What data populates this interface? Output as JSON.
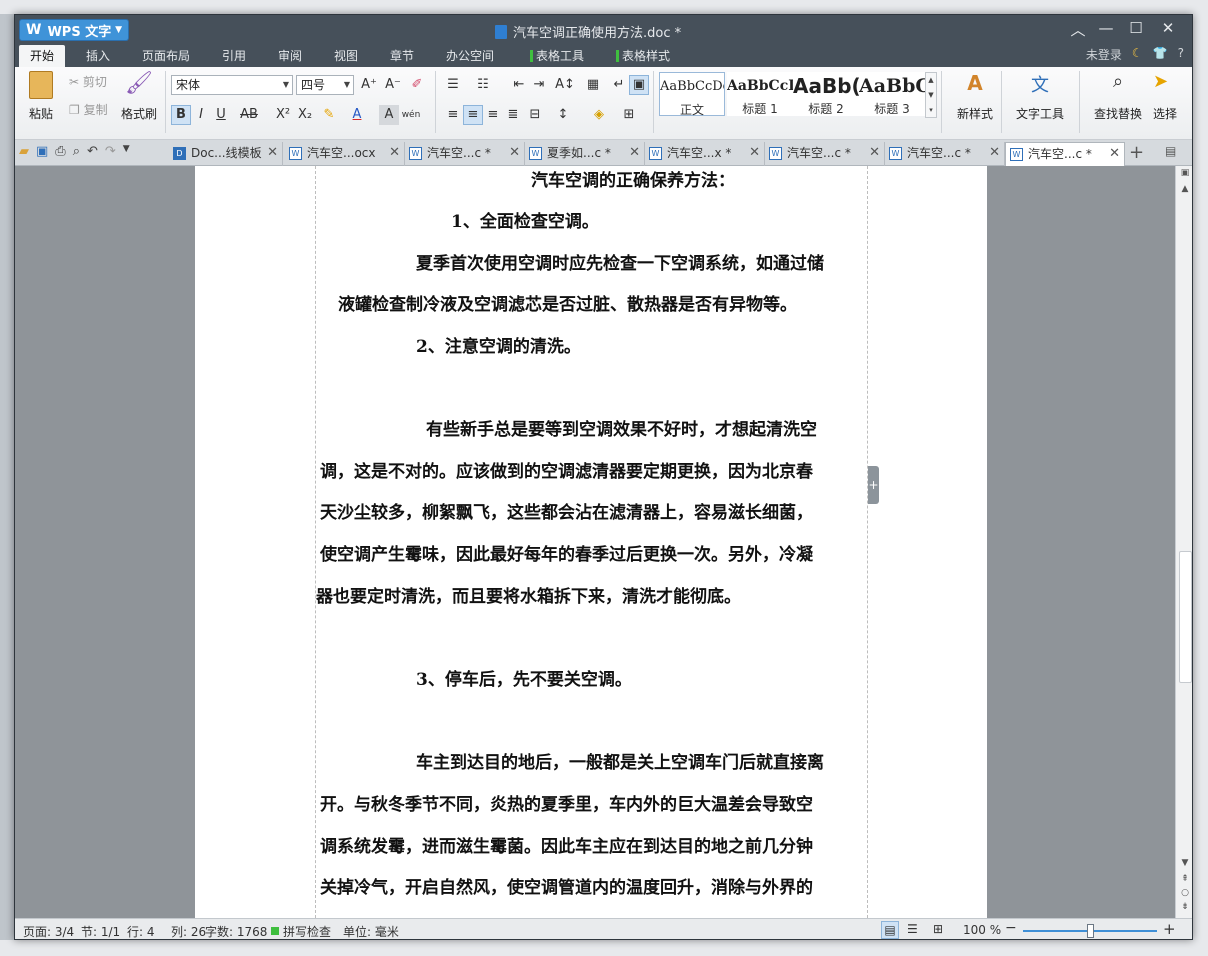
{
  "app": {
    "name": "WPS 文字",
    "doc_title": "汽车空调正确使用方法.doc *"
  },
  "menu": {
    "tabs": [
      "开始",
      "插入",
      "页面布局",
      "引用",
      "审阅",
      "视图",
      "章节",
      "办公空间",
      "表格工具",
      "表格样式"
    ],
    "login": "未登录",
    "help": "?"
  },
  "ribbon": {
    "paste": "粘贴",
    "cut": "剪切",
    "copy": "复制",
    "format_painter": "格式刷",
    "font_name": "宋体",
    "font_size": "四号",
    "styles": [
      {
        "preview": "AaBbCcDd",
        "name": "正文"
      },
      {
        "preview": "AaBbCcDd",
        "name": "标题 1"
      },
      {
        "preview": "AaBb(",
        "name": "标题 2"
      },
      {
        "preview": "AaBbC",
        "name": "标题 3"
      }
    ],
    "new_style": "新样式",
    "text_tools": "文字工具",
    "find_replace": "查找替换",
    "select": "选择"
  },
  "doc_tabs": [
    "Doc...线模板",
    "汽车空...ocx",
    "汽车空...c *",
    "夏季如...c *",
    "汽车空...x *",
    "汽车空...c *",
    "汽车空...c *",
    "汽车空...c *"
  ],
  "document": {
    "paragraphs": [
      "汽车空调的正确保养方法：",
      "1、全面检查空调。",
      "夏季首次使用空调时应先检查一下空调系统，如通过储",
      "液罐检查制冷液及空调滤芯是否过脏、散热器是否有异物等。",
      "2、注意空调的清洗。",
      "有些新手总是要等到空调效果不好时，才想起清洗空",
      "调，这是不对的。应该做到的空调滤清器要定期更换，因为北京春",
      "天沙尘较多，柳絮飘飞，这些都会沾在滤清器上，容易滋长细菌，",
      "使空调产生霉味，因此最好每年的春季过后更换一次。另外，冷凝",
      "器也要定时清洗，而且要将水箱拆下来，清洗才能彻底。",
      "3、停车后，先不要关空调。",
      "车主到达目的地后，一般都是关上空调车门后就直接离",
      "开。与秋冬季节不同，炎热的夏季里，车内外的巨大温差会导致空",
      "调系统发霉，进而滋生霉菌。因此车主应在到达目的地之前几分钟",
      "关掉冷气，开启自然风，使空调管道内的温度回升，消除与外界的"
    ]
  },
  "status": {
    "page": "页面: 3/4",
    "section": "节: 1/1",
    "row": "行: 4",
    "col": "列: 26",
    "words": "字数: 1768",
    "spell": "拼写检查",
    "unit": "单位: 毫米",
    "zoom": "100 %"
  },
  "colors": {
    "title_bar": "#46505a",
    "accent": "#3f93d8",
    "table_tab_marker": "#3fbf3f"
  }
}
